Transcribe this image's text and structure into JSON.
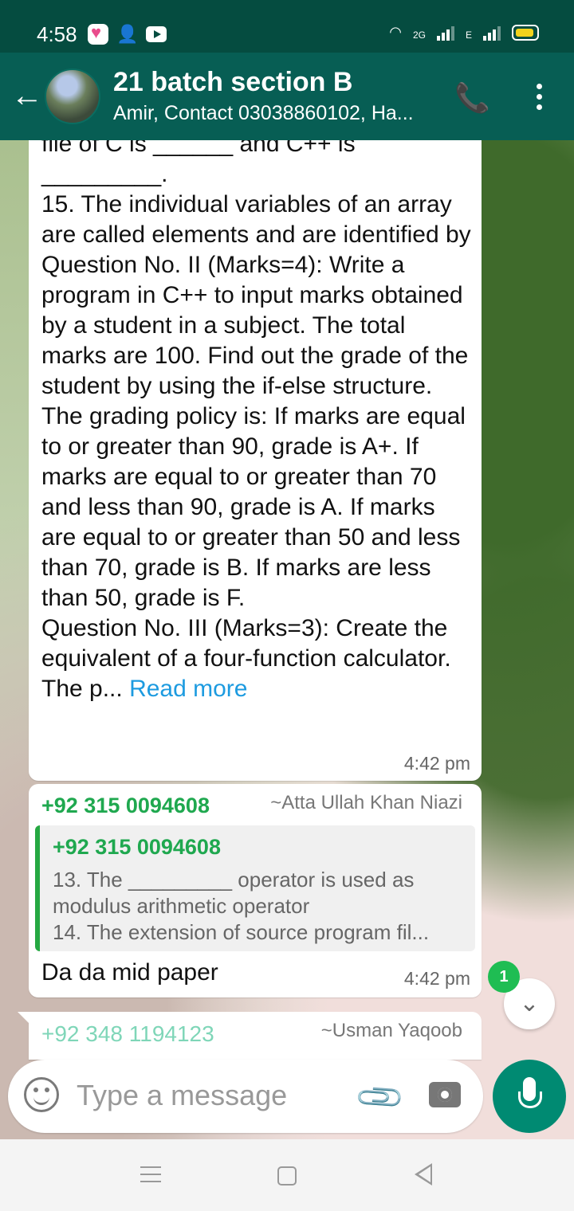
{
  "status_bar": {
    "time": "4:58",
    "network_label": "2G",
    "sim_label": "E"
  },
  "header": {
    "title": "21 batch section B",
    "subtitle": "Amir, Contact 03038860102, Ha..."
  },
  "messages": [
    {
      "body": "file of C is ______ and C++ is\n_________.\n15. The individual variables of an array are called elements and are identified by\nQuestion No. II (Marks=4): Write a program in C++ to input marks obtained by a student in a subject. The total marks are 100. Find out the grade of the student by using the if-else structure. The grading policy is: If marks are equal to or greater than 90, grade is A+. If marks are equal to or greater than 70 and less than 90, grade is A. If marks are equal to or greater than 50 and less than 70, grade is B. If marks are less than 50, grade is F.\nQuestion No. III (Marks=3): Create the equivalent of a four-function calculator. The p... ",
      "read_more": "Read more",
      "time": "4:42 pm"
    },
    {
      "sender": "+92 315 0094608",
      "alias": "~Atta Ullah Khan Niazi",
      "quote_sender": "+92 315 0094608",
      "quote_text": "13. The _________ operator is used as modulus arithmetic operator\n14. The extension of source program fil...",
      "text": "Da da mid paper",
      "time": "4:42 pm"
    },
    {
      "sender": "+92 348 1194123",
      "alias": "~Usman Yaqoob"
    }
  ],
  "unread_count": "1",
  "composer": {
    "placeholder": "Type a message"
  },
  "colors": {
    "app_bar": "#075e54",
    "status_bar": "#054c40",
    "sender_green": "#1fa84f",
    "link_blue": "#1d9be0",
    "mic_button": "#008a72"
  }
}
